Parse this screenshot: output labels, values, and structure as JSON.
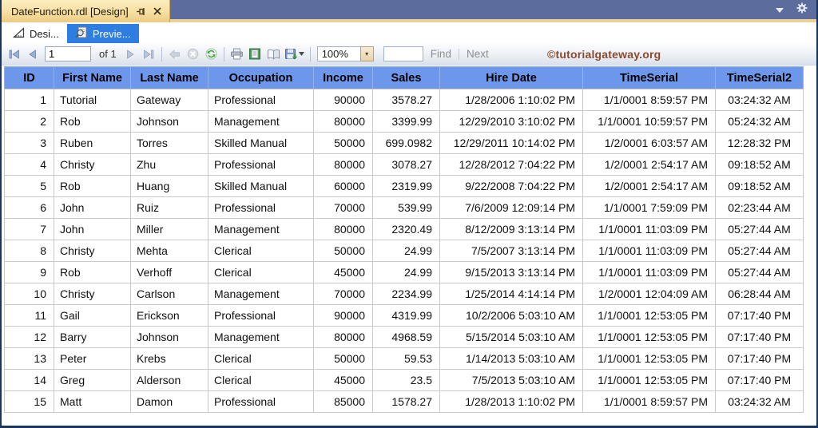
{
  "window": {
    "title": "DateFunction.rdl [Design]",
    "title_bar_color": "#5b6c9d",
    "active_doc_tab_color": "#f6dfa2",
    "border_color": "#17355f"
  },
  "tabs": {
    "design": {
      "label": "Desi..."
    },
    "preview": {
      "label": "Previe...",
      "active": true,
      "active_color": "#2e7de0"
    }
  },
  "toolbar": {
    "page_value": "1",
    "of_label": "of 1",
    "zoom_value": "100%",
    "find_value": "",
    "find_label": "Find",
    "next_label": "Next"
  },
  "watermark": {
    "text": "©tutorialgateway.org",
    "color": "#8a4a2d"
  },
  "table": {
    "header_color": "#6d97ea",
    "columns": [
      "ID",
      "First Name",
      "Last Name",
      "Occupation",
      "Income",
      "Sales",
      "Hire Date",
      "TimeSerial",
      "TimeSerial2"
    ],
    "rows": [
      [
        "1",
        "Tutorial",
        "Gateway",
        "Professional",
        "90000",
        "3578.27",
        "1/28/2006 1:10:02 PM",
        "1/1/0001 8:59:57 PM",
        "03:24:32 AM"
      ],
      [
        "2",
        "Rob",
        "Johnson",
        "Management",
        "80000",
        "3399.99",
        "12/29/2010 3:10:02 PM",
        "1/1/0001 10:59:57 PM",
        "05:24:32 AM"
      ],
      [
        "3",
        "Ruben",
        "Torres",
        "Skilled Manual",
        "50000",
        "699.0982",
        "12/29/2011 10:14:02 PM",
        "1/2/0001 6:03:57 AM",
        "12:28:32 PM"
      ],
      [
        "4",
        "Christy",
        "Zhu",
        "Professional",
        "80000",
        "3078.27",
        "12/28/2012 7:04:22 PM",
        "1/2/0001 2:54:17 AM",
        "09:18:52 AM"
      ],
      [
        "5",
        "Rob",
        "Huang",
        "Skilled Manual",
        "60000",
        "2319.99",
        "9/22/2008 7:04:22 PM",
        "1/2/0001 2:54:17 AM",
        "09:18:52 AM"
      ],
      [
        "6",
        "John",
        "Ruiz",
        "Professional",
        "70000",
        "539.99",
        "7/6/2009 12:09:14 PM",
        "1/1/0001 7:59:09 PM",
        "02:23:44 AM"
      ],
      [
        "7",
        "John",
        "Miller",
        "Management",
        "80000",
        "2320.49",
        "8/12/2009 3:13:14 PM",
        "1/1/0001 11:03:09 PM",
        "05:27:44 AM"
      ],
      [
        "8",
        "Christy",
        "Mehta",
        "Clerical",
        "50000",
        "24.99",
        "7/5/2007 3:13:14 PM",
        "1/1/0001 11:03:09 PM",
        "05:27:44 AM"
      ],
      [
        "9",
        "Rob",
        "Verhoff",
        "Clerical",
        "45000",
        "24.99",
        "9/15/2013 3:13:14 PM",
        "1/1/0001 11:03:09 PM",
        "05:27:44 AM"
      ],
      [
        "10",
        "Christy",
        "Carlson",
        "Management",
        "70000",
        "2234.99",
        "1/25/2014 4:14:14 PM",
        "1/2/0001 12:04:09 AM",
        "06:28:44 AM"
      ],
      [
        "11",
        "Gail",
        "Erickson",
        "Professional",
        "90000",
        "4319.99",
        "10/2/2006 5:03:10 AM",
        "1/1/0001 12:53:05 PM",
        "07:17:40 PM"
      ],
      [
        "12",
        "Barry",
        "Johnson",
        "Management",
        "80000",
        "4968.59",
        "5/15/2014 5:03:10 AM",
        "1/1/0001 12:53:05 PM",
        "07:17:40 PM"
      ],
      [
        "13",
        "Peter",
        "Krebs",
        "Clerical",
        "50000",
        "59.53",
        "1/14/2013 5:03:10 AM",
        "1/1/0001 12:53:05 PM",
        "07:17:40 PM"
      ],
      [
        "14",
        "Greg",
        "Alderson",
        "Clerical",
        "45000",
        "23.5",
        "7/5/2013 5:03:10 AM",
        "1/1/0001 12:53:05 PM",
        "07:17:40 PM"
      ],
      [
        "15",
        "Matt",
        "Damon",
        "Professional",
        "85000",
        "1578.27",
        "1/28/2013 1:10:02 PM",
        "1/1/0001 8:59:57 PM",
        "03:24:32 AM"
      ]
    ]
  }
}
